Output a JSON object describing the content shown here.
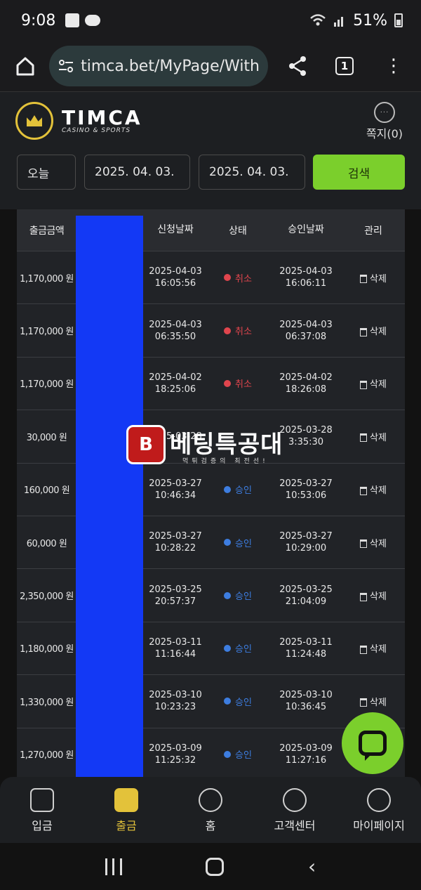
{
  "status_bar": {
    "time": "9:08",
    "battery": "51%"
  },
  "browser": {
    "url": "timca.bet/MyPage/With",
    "tab_count": "1"
  },
  "header": {
    "logo_text": "TIMCA",
    "logo_sub": "CASINO & SPORTS",
    "logo_badge_text": "CASINO & SPORTS",
    "message_label": "쪽지(0)"
  },
  "filters": {
    "period": "오늘",
    "date_from": "2025. 04. 03.",
    "date_to": "2025. 04. 03.",
    "search_label": "검색"
  },
  "table": {
    "columns": [
      "출금금액",
      "",
      "신청날짜",
      "상태",
      "승인날짜",
      "관리"
    ],
    "rows": [
      {
        "amount": "1,170,000 원",
        "req_date": "2025-04-03",
        "req_time": "16:05:56",
        "status": "취소",
        "appr_date": "2025-04-03",
        "appr_time": "16:06:11",
        "action": "삭제"
      },
      {
        "amount": "1,170,000 원",
        "req_date": "2025-04-03",
        "req_time": "06:35:50",
        "status": "취소",
        "appr_date": "2025-04-03",
        "appr_time": "06:37:08",
        "action": "삭제"
      },
      {
        "amount": "1,170,000 원",
        "req_date": "2025-04-02",
        "req_time": "18:25:06",
        "status": "취소",
        "appr_date": "2025-04-02",
        "appr_time": "18:26:08",
        "action": "삭제"
      },
      {
        "amount": "30,000 원",
        "req_date": "2025-03-28",
        "req_time": "",
        "status": "",
        "appr_date": "2025-03-28",
        "appr_time": "3:35:30",
        "action": "삭제"
      },
      {
        "amount": "160,000 원",
        "req_date": "2025-03-27",
        "req_time": "10:46:34",
        "status": "승인",
        "appr_date": "2025-03-27",
        "appr_time": "10:53:06",
        "action": "삭제"
      },
      {
        "amount": "60,000 원",
        "req_date": "2025-03-27",
        "req_time": "10:28:22",
        "status": "승인",
        "appr_date": "2025-03-27",
        "appr_time": "10:29:00",
        "action": "삭제"
      },
      {
        "amount": "2,350,000 원",
        "req_date": "2025-03-25",
        "req_time": "20:57:37",
        "status": "승인",
        "appr_date": "2025-03-25",
        "appr_time": "21:04:09",
        "action": "삭제"
      },
      {
        "amount": "1,180,000 원",
        "req_date": "2025-03-11",
        "req_time": "11:16:44",
        "status": "승인",
        "appr_date": "2025-03-11",
        "appr_time": "11:24:48",
        "action": "삭제"
      },
      {
        "amount": "1,330,000 원",
        "req_date": "2025-03-10",
        "req_time": "10:23:23",
        "status": "승인",
        "appr_date": "2025-03-10",
        "appr_time": "10:36:45",
        "action": "삭제"
      },
      {
        "amount": "1,270,000 원",
        "req_date": "2025-03-09",
        "req_time": "11:25:32",
        "status": "승인",
        "appr_date": "2025-03-09",
        "appr_time": "11:27:16",
        "action": ""
      }
    ]
  },
  "watermark": {
    "badge": "B",
    "title": "베팅특공대",
    "sub": "먹튀검증의 최전선!"
  },
  "bottom_nav": {
    "items": [
      {
        "label": "입금",
        "icon": "deposit-icon"
      },
      {
        "label": "출금",
        "icon": "withdraw-icon"
      },
      {
        "label": "홈",
        "icon": "home-check-icon"
      },
      {
        "label": "고객센터",
        "icon": "headset-icon"
      },
      {
        "label": "마이페이지",
        "icon": "user-icon"
      }
    ]
  },
  "colors": {
    "accent": "#7bcf2c",
    "gold": "#e3c23a",
    "cancel": "#e0454d",
    "approve": "#3d7de0",
    "mask": "#1339f5"
  }
}
